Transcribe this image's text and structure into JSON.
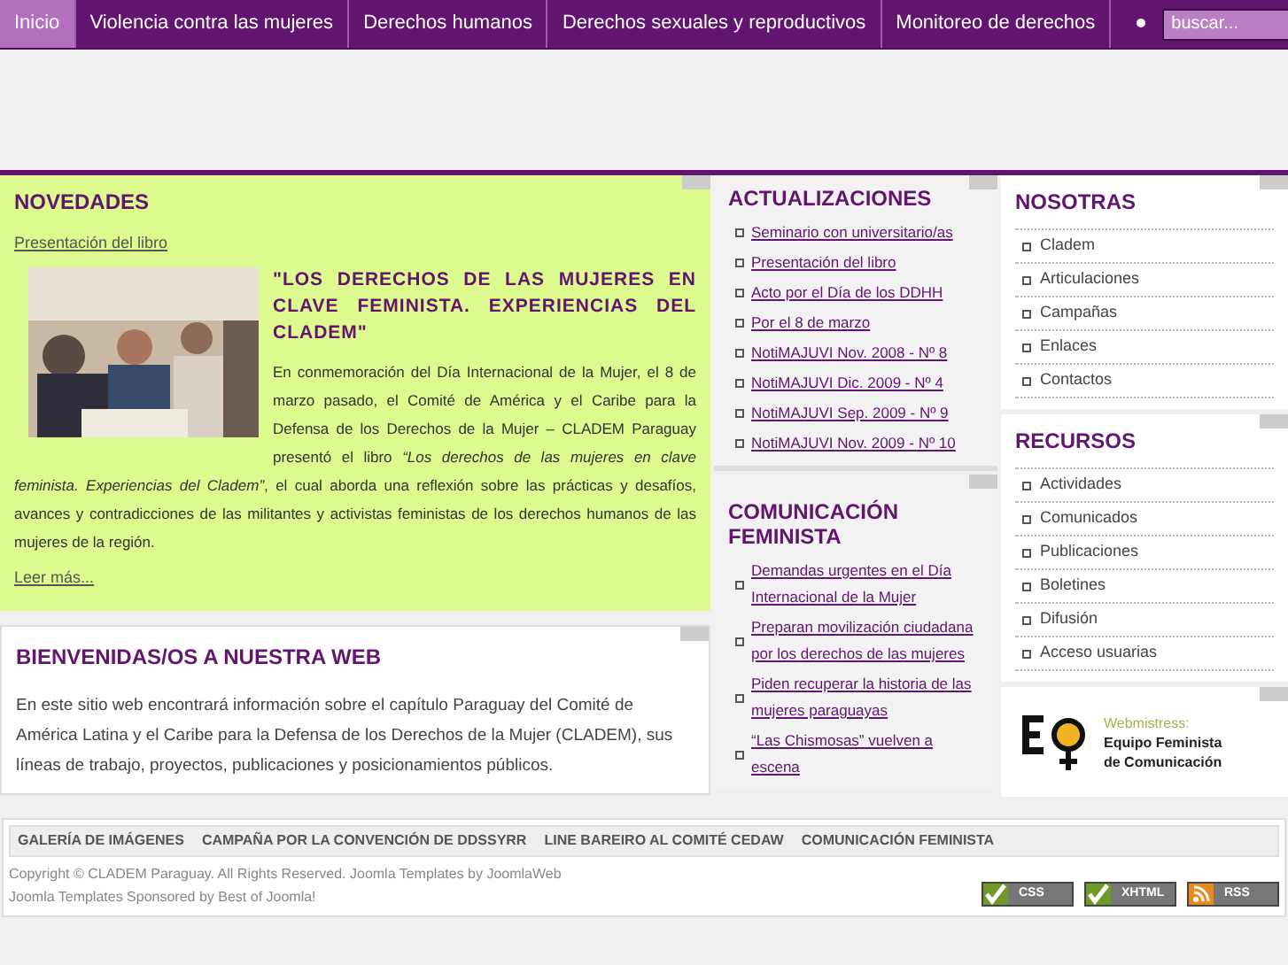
{
  "nav": {
    "items": [
      {
        "label": "Inicio",
        "selected": true
      },
      {
        "label": "Violencia contra las mujeres",
        "selected": false
      },
      {
        "label": "Derechos humanos",
        "selected": false
      },
      {
        "label": "Derechos sexuales y reproductivos",
        "selected": false
      },
      {
        "label": "Monitoreo de derechos",
        "selected": false
      }
    ],
    "search": {
      "placeholder": "buscar..."
    }
  },
  "novedades": {
    "title": "NOVEDADES",
    "link": "Presentación del libro",
    "heading": "\"LOS DERECHOS DE LAS MUJERES EN CLAVE FEMINISTA. EXPERIENCIAS DEL CLADEM\"",
    "body": "En conmemoración del Día Internacional de la Mujer, el 8 de marzo pasado, el Comité de América y el Caribe para la Defensa de los Derechos de la Mujer – CLADEM Paraguay presentó el libro *“Los derechos de las mujeres en clave feminista. Experiencias del Cladem”*, el cual aborda una reflexión sobre las prácticas y desafíos, avances y contradicciones de las militantes y activistas feministas de los derechos humanos de las mujeres de la región.",
    "more": "Leer más..."
  },
  "welcome": {
    "title": "BIENVENIDAS/OS A NUESTRA WEB",
    "text": "En este sitio web encontrará información sobre el capítulo Paraguay del Comité de América Latina y el Caribe para la Defensa de los Derechos de la Mujer (CLADEM), sus líneas de trabajo, proyectos, publicaciones y posicionamientos públicos."
  },
  "actualizaciones": {
    "title": "ACTUALIZACIONES",
    "items": [
      "Seminario con universitario/as",
      "Presentación del libro",
      "Acto por el Día de los DDHH",
      "Por el 8 de marzo",
      "NotiMAJUVI Nov. 2008 - Nº 8",
      "NotiMAJUVI Dic. 2009 - Nº 4",
      "NotiMAJUVI Sep. 2009 - Nº 9",
      "NotiMAJUVI Nov. 2009 - Nº 10"
    ]
  },
  "comunicacion": {
    "title": "COMUNICACIÓN FEMINISTA",
    "items": [
      "Demandas urgentes en el Día Internacional de la Mujer",
      "Preparan movilización ciudadana por los derechos de las mujeres",
      "Piden recuperar la historia de las mujeres paraguayas",
      "“Las Chismosas” vuelven a escena"
    ]
  },
  "nosotras": {
    "title": "NOSOTRAS",
    "items": [
      "Cladem",
      "Articulaciones",
      "Campañas",
      "Enlaces",
      "Contactos"
    ]
  },
  "recursos": {
    "title": "RECURSOS",
    "items": [
      "Actividades",
      "Comunicados",
      "Publicaciones",
      "Boletines",
      "Difusión",
      "Acceso usuarias"
    ]
  },
  "webmistress": {
    "label": "Webmistress:",
    "name": "Equipo Feminista",
    "name2": "de Comunicación"
  },
  "footer": {
    "links": [
      "GALERÍA DE IMÁGENES",
      "CAMPAÑA POR LA CONVENCIÓN DE DDSSYRR",
      "LINE BAREIRO AL COMITÉ CEDAW",
      "COMUNICACIÓN FEMINISTA"
    ],
    "copyright": "Copyright © CLADEM Paraguay. All Rights Reserved. Joomla Templates by JoomlaWeb",
    "sponsor": "Joomla Templates Sponsored by Best of Joomla!",
    "badges": [
      {
        "kind": "check",
        "label": "CSS"
      },
      {
        "kind": "check",
        "label": "XHTML"
      },
      {
        "kind": "rss",
        "label": "RSS"
      }
    ]
  }
}
